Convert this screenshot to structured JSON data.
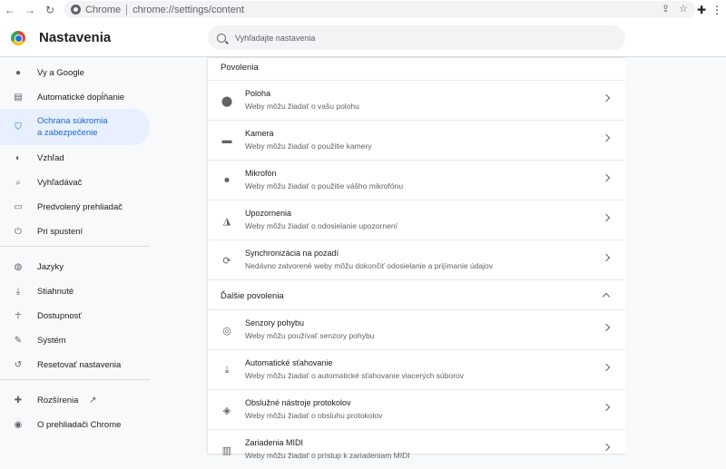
{
  "browser": {
    "scheme_label": "Chrome",
    "url": "chrome://settings/content"
  },
  "header": {
    "title": "Nastavenia",
    "search_placeholder": "Vyhľadajte nastavenia"
  },
  "sidebar": {
    "items": [
      {
        "label": "Vy a Google",
        "icon": "person-icon"
      },
      {
        "label": "Automatické dopĺňanie",
        "icon": "clipboard-icon"
      },
      {
        "label": "Ochrana súkromia a zabezpečenie",
        "icon": "shield-icon",
        "active": true
      },
      {
        "label": "Vzhľad",
        "icon": "palette-icon"
      },
      {
        "label": "Vyhľadávač",
        "icon": "search-icon"
      },
      {
        "label": "Predvolený prehliadač",
        "icon": "browser-icon"
      },
      {
        "label": "Pri spustení",
        "icon": "power-icon"
      },
      {
        "label": "Jazyky",
        "icon": "globe-icon"
      },
      {
        "label": "Stiahnuté",
        "icon": "download-icon"
      },
      {
        "label": "Dostupnosť",
        "icon": "accessibility-icon"
      },
      {
        "label": "Systém",
        "icon": "wrench-icon"
      },
      {
        "label": "Resetovať nastavenia",
        "icon": "history-icon"
      },
      {
        "label": "Rozšírenia",
        "icon": "puzzle-icon"
      },
      {
        "label": "O prehliadači Chrome",
        "icon": "chrome-icon"
      }
    ],
    "active_lines": [
      "Ochrana súkromia",
      "a zabezpečenie"
    ]
  },
  "main": {
    "section_permissions": "Povolenia",
    "section_more": "Ďalšie povolenia",
    "permissions": [
      {
        "title": "Poloha",
        "sub": "Weby môžu žiadať o vašu polohu",
        "icon": "location-icon"
      },
      {
        "title": "Kamera",
        "sub": "Weby môžu žiadať o použitie kamery",
        "icon": "camera-icon"
      },
      {
        "title": "Mikrofón",
        "sub": "Weby môžu žiadať o použitie vášho mikrofónu",
        "icon": "microphone-icon"
      },
      {
        "title": "Upozornenia",
        "sub": "Weby môžu žiadať o odosielanie upozornení",
        "icon": "bell-icon"
      },
      {
        "title": "Synchronizácia na pozadí",
        "sub": "Nedávno zatvorené weby môžu dokončiť odosielanie a prijímanie údajov",
        "icon": "sync-icon"
      }
    ],
    "more": [
      {
        "title": "Senzory pohybu",
        "sub": "Weby môžu používať senzory pohybu",
        "icon": "sensors-icon"
      },
      {
        "title": "Automatické sťahovanie",
        "sub": "Weby môžu žiadať o automatické sťahovanie viacerých súborov",
        "icon": "download-icon"
      },
      {
        "title": "Obslužné nástroje protokolov",
        "sub": "Weby môžu žiadať o obsluhu protokolov",
        "icon": "protocol-icon"
      },
      {
        "title": "Zariadenia MIDI",
        "sub": "Weby môžu žiadať o prístup k zariadeniam MIDI",
        "icon": "piano-icon"
      }
    ]
  }
}
